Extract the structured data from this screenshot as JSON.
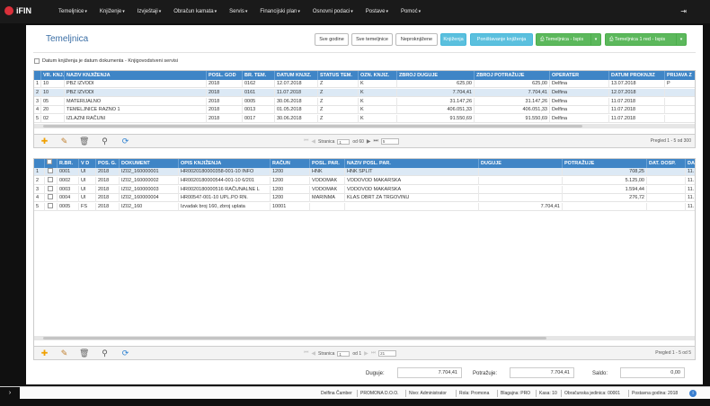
{
  "app": {
    "name": "iFIN"
  },
  "menu": [
    {
      "label": "Temeljnice"
    },
    {
      "label": "Knjiženje"
    },
    {
      "label": "Izvještaji"
    },
    {
      "label": "Obračun kamata"
    },
    {
      "label": "Servis"
    },
    {
      "label": "Financijski plan"
    },
    {
      "label": "Osnovni podaci"
    },
    {
      "label": "Postave"
    },
    {
      "label": "Pomoć"
    }
  ],
  "page": {
    "title": "Temeljnica"
  },
  "toolbar": {
    "sve_godine": "Sve godine",
    "sve_temeljnice": "Sve temeljnice",
    "neproknjizene": "Neproknjižene",
    "knjizenja": "Knjiženja",
    "ponistavanje": "Poništavanje knjiženja",
    "ispis1": "Temeljnica - Ispis",
    "ispis2": "Temeljnica 1 red - Ispis"
  },
  "option": {
    "label": "Datum knjiženja je datum dokumenta - Knjigovodstveni servisi"
  },
  "grid1": {
    "columns": [
      "",
      "VR. KNJ.",
      "NAZIV KNJIŽENJA",
      "POSL. GOD",
      "BR. TEM.",
      "DATUM KNJIZ.",
      "STATUS TEM.",
      "OZN. KNJIZ.",
      "ZBROJ DUGUJE",
      "ZBROJ POTRAŽUJE",
      "OPERATER",
      "DATUM PROKNJIZ",
      "PRIJAVA Z"
    ],
    "rows": [
      [
        "1",
        "10",
        "PBZ IZVODI",
        "2018",
        "0162",
        "12.07.2018",
        "Z",
        "K",
        "625,00",
        "625,00",
        "Delfina",
        "13.07.2018",
        "P"
      ],
      [
        "2",
        "10",
        "PBZ IZVODI",
        "2018",
        "0161",
        "11.07.2018",
        "Z",
        "K",
        "7.704,41",
        "7.704,41",
        "Delfina",
        "12.07.2018",
        ""
      ],
      [
        "3",
        "05",
        "MATERIJALNO",
        "2018",
        "0005",
        "30.06.2018",
        "Z",
        "K",
        "31.147,26",
        "31.147,26",
        "Delfina",
        "11.07.2018",
        ""
      ],
      [
        "4",
        "20",
        "TEMELJNICE RAZNO 1",
        "2018",
        "0013",
        "01.05.2018",
        "Z",
        "K",
        "406.051,33",
        "406.051,33",
        "Delfina",
        "11.07.2018",
        ""
      ],
      [
        "5",
        "02",
        "IZLAZNI RAČUNI",
        "2018",
        "0017",
        "30.06.2018",
        "Z",
        "K",
        "91.550,69",
        "91.550,69",
        "Delfina",
        "11.07.2018",
        ""
      ]
    ],
    "pager": {
      "label": "Stranica",
      "page": "1",
      "of": "od 60",
      "size": "5",
      "info": "Pregled 1 - 5 od 300"
    }
  },
  "grid2": {
    "columns": [
      "",
      "",
      "R.BR.",
      "V D",
      "POS. G.",
      "DOKUMENT",
      "OPIS KNJIŽENJA",
      "RAČUN",
      "POSL. PAR.",
      "NAZIV POSL. PAR.",
      "DUGUJE",
      "POTRAŽUJE",
      "DAT. DOSP.",
      "DA"
    ],
    "rows": [
      [
        "1",
        "0001",
        "UI",
        "2018",
        "IZ02_160000001",
        "HR0020180000358-001-10 INFO",
        "1200",
        "HNK",
        "HNK SPLIT",
        "",
        "708,25",
        "",
        "11."
      ],
      [
        "2",
        "0002",
        "UI",
        "2018",
        "IZ02_160000002",
        "HR0020180000544-001-10 6/201",
        "1200",
        "VODOMAK",
        "VODOVOD MAKARSKA",
        "",
        "5.125,00",
        "",
        "11."
      ],
      [
        "3",
        "0003",
        "UI",
        "2018",
        "IZ02_160000003",
        "HR0020180000516 RAČUNALNE L",
        "1200",
        "VODOMAK",
        "VODOVOD MAKARSKA",
        "",
        "1.594,44",
        "",
        "11."
      ],
      [
        "4",
        "0004",
        "UI",
        "2018",
        "IZ02_160000004",
        "HR00547-001-10 UPL.PO RN.",
        "1200",
        "MARINMA",
        "KLAS OBRT ZA TRGOVINU",
        "",
        "276,72",
        "",
        "11."
      ],
      [
        "5",
        "0005",
        "FS",
        "2018",
        "IZ02_160",
        "Izvadak broj 160, zbroj uplata",
        "10001",
        "",
        "",
        "7.704,41",
        "",
        "",
        "11."
      ]
    ],
    "pager": {
      "label": "Stranica",
      "page": "1",
      "of": "od 1",
      "size": "21",
      "info": "Pregled 1 - 5 od 5"
    }
  },
  "summary": {
    "duguje_label": "Duguje:",
    "duguje": "7.704,41",
    "potrazuje_label": "Potražuje:",
    "potrazuje": "7.704,41",
    "saldo_label": "Saldo:",
    "saldo": "0,00"
  },
  "status": {
    "user": "Delfina Čamber",
    "company": "PROMONA D.O.O.",
    "nivo": "Nivo: Administrator",
    "rola": "Rola: Promona",
    "blagajna": "Blagajna: PRO",
    "kasa": "Kasa: 10",
    "obrac": "Obračunska jedinica: 00001",
    "godina": "Postavna godina: 2018"
  }
}
